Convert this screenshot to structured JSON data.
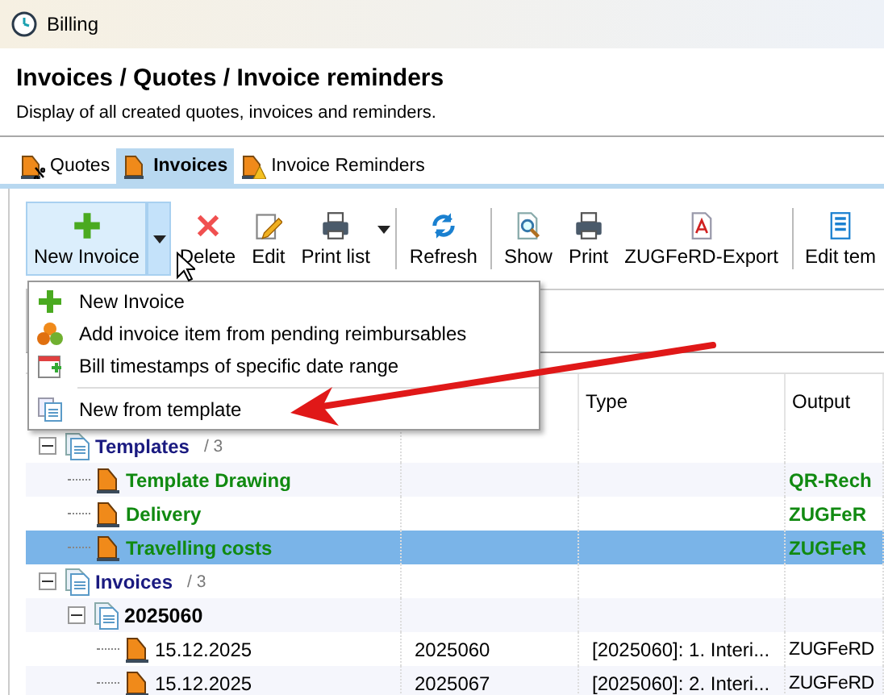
{
  "window": {
    "title": "Billing"
  },
  "header": {
    "title": "Invoices / Quotes / Invoice reminders",
    "description": "Display of all created quotes, invoices and reminders."
  },
  "tabs": [
    {
      "label": "Quotes",
      "selected": false
    },
    {
      "label": "Invoices",
      "selected": true
    },
    {
      "label": "Invoice Reminders",
      "selected": false
    }
  ],
  "toolbar": [
    {
      "kind": "split",
      "label": "New Invoice",
      "pressed": true
    },
    {
      "kind": "button",
      "label": "Delete"
    },
    {
      "kind": "button",
      "label": "Edit"
    },
    {
      "kind": "button",
      "label": "Print list"
    },
    {
      "kind": "caret"
    },
    {
      "kind": "separator"
    },
    {
      "kind": "button",
      "label": "Refresh"
    },
    {
      "kind": "separator"
    },
    {
      "kind": "button",
      "label": "Show"
    },
    {
      "kind": "button",
      "label": "Print"
    },
    {
      "kind": "button",
      "label": "ZUGFeRD-Export"
    },
    {
      "kind": "separator"
    },
    {
      "kind": "button",
      "label": "Edit tem"
    }
  ],
  "dropdown_menu": {
    "items": [
      {
        "kind": "item",
        "label": "New Invoice"
      },
      {
        "kind": "item",
        "label": "Add invoice item from pending reimbursables"
      },
      {
        "kind": "item",
        "label": "Bill timestamps of specific date range"
      },
      {
        "kind": "separator"
      },
      {
        "kind": "item",
        "label": "New from template"
      }
    ]
  },
  "table": {
    "columns": [
      "Type",
      "Output"
    ],
    "rows": [
      {
        "kind": "folder",
        "label": "Templates",
        "count": "/ 3",
        "expanded": true,
        "children": [
          {
            "kind": "template",
            "label": "Template Drawing",
            "output": "QR-Rech",
            "selected": false
          },
          {
            "kind": "template",
            "label": "Delivery",
            "output": "ZUGFeR",
            "selected": false
          },
          {
            "kind": "template",
            "label": "Travelling costs",
            "output": "ZUGFeR",
            "selected": true
          }
        ]
      },
      {
        "kind": "folder",
        "label": "Invoices",
        "count": "/ 3",
        "expanded": true,
        "children": [
          {
            "kind": "group",
            "label": "2025060",
            "expanded": true,
            "children": [
              {
                "kind": "invoice",
                "label": "15.12.2025",
                "number": "2025060",
                "type": "[2025060]: 1. Interi...",
                "output": "ZUGFeRD",
                "selected": false
              },
              {
                "kind": "invoice",
                "label": "15.12.2025",
                "number": "2025067",
                "type": "[2025060]: 2. Interi...",
                "output": "ZUGFeRD",
                "selected": false
              }
            ]
          }
        ]
      }
    ]
  }
}
